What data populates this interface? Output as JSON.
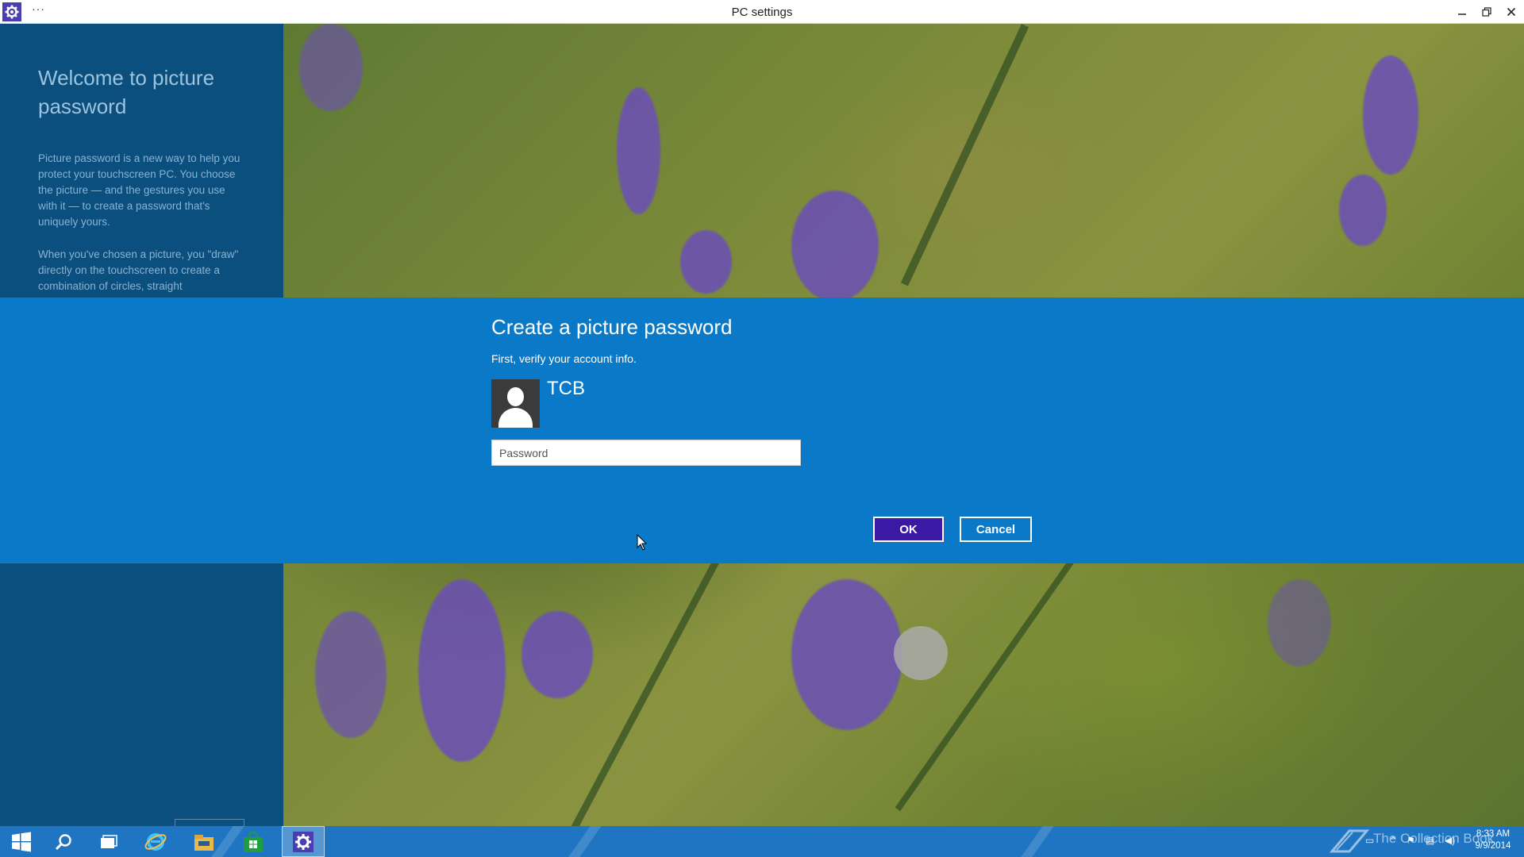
{
  "window": {
    "title": "PC settings",
    "menu_label": "···",
    "controls": [
      "minimize",
      "restore",
      "close"
    ]
  },
  "left_panel": {
    "title": "Welcome to picture password",
    "paragraph1": "Picture password is a new way to help you protect your touchscreen PC. You choose the picture — and the gestures you use with it — to create a password that's uniquely yours.",
    "paragraph2": "When you've chosen a picture, you \"draw\" directly on the touchscreen to create a combination of circles, straight"
  },
  "dialog": {
    "title": "Create a picture password",
    "subtitle": "First, verify your account info.",
    "user_name": "TCB",
    "password_placeholder": "Password",
    "password_value": "",
    "ok_label": "OK",
    "cancel_label": "Cancel"
  },
  "taskbar": {
    "pinned": [
      "start-icon",
      "search-icon",
      "task-view-icon",
      "internet-explorer-icon",
      "file-explorer-icon",
      "store-icon",
      "settings-icon"
    ],
    "active": "settings-icon",
    "watermark": "The Collection Book",
    "clock_time": "8:33 AM",
    "clock_date": "9/9/2014"
  },
  "colors": {
    "dialog_bg": "#0a7ac8",
    "left_panel_bg": "#0a4f7d",
    "ok_button_bg": "#3a1aa5",
    "taskbar_bg": "#1f75c2",
    "app_icon_bg": "#4b3fb0"
  }
}
